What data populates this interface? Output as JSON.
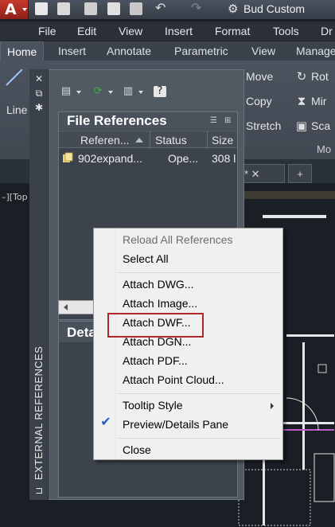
{
  "app": {
    "workspace_name": "Bud Custom",
    "app_letter": "A"
  },
  "menu": [
    "File",
    "Edit",
    "View",
    "Insert",
    "Format",
    "Tools",
    "Dr"
  ],
  "ribbon_tabs": [
    "Home",
    "Insert",
    "Annotate",
    "Parametric",
    "View",
    "Manage"
  ],
  "ribbon": {
    "line_label": "Line",
    "move": "Move",
    "copy": "Copy",
    "stretch": "Stretch",
    "rotate": "Rot",
    "mirror": "Mir",
    "scale": "Sca",
    "panel_title": "Mo"
  },
  "viewport_label": "–][Top",
  "palette": {
    "title": "EXTERNAL REFERENCES",
    "file_references_title": "File References",
    "columns": [
      "Referen...",
      "Status",
      "Size"
    ],
    "rows": [
      {
        "name": "902expand...",
        "status": "Ope...",
        "size": "308 l"
      }
    ],
    "details_title": "Deta"
  },
  "context_menu": {
    "items": [
      {
        "label": "Reload All References",
        "disabled": true
      },
      {
        "label": "Select All",
        "disabled": false
      },
      {
        "label": "Attach DWG...",
        "disabled": false
      },
      {
        "label": "Attach Image...",
        "disabled": false
      },
      {
        "label": "Attach DWF...",
        "disabled": false,
        "highlighted": true
      },
      {
        "label": "Attach DGN...",
        "disabled": false
      },
      {
        "label": "Attach PDF...",
        "disabled": false
      },
      {
        "label": "Attach Point Cloud...",
        "disabled": false
      },
      {
        "label": "Tooltip Style",
        "disabled": false,
        "submenu": true
      },
      {
        "label": "Preview/Details Pane",
        "disabled": false,
        "checked": true
      },
      {
        "label": "Close",
        "disabled": false
      }
    ]
  },
  "colors": {
    "highlight_box": "#b0262b",
    "check": "#245ec8",
    "menu_bg": "#f0f0f0"
  }
}
